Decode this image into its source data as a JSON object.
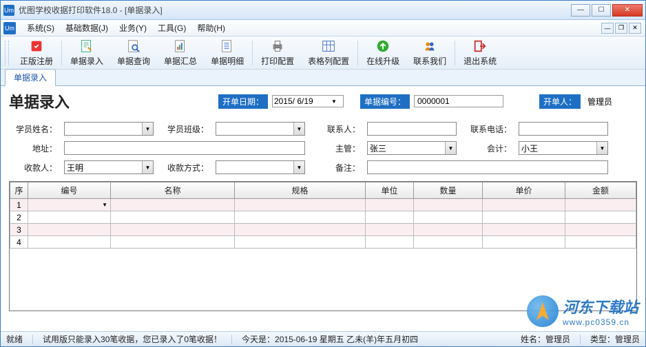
{
  "window": {
    "title": "优图学校收据打印软件18.0 - [单据录入]",
    "app_icon": "Um"
  },
  "menu": {
    "items": [
      "系统(S)",
      "基础数据(J)",
      "业务(Y)",
      "工具(G)",
      "帮助(H)"
    ]
  },
  "toolbar": {
    "items": [
      {
        "label": "正版注册",
        "icon": "register"
      },
      {
        "label": "单据录入",
        "icon": "input"
      },
      {
        "label": "单据查询",
        "icon": "query"
      },
      {
        "label": "单据汇总",
        "icon": "summary"
      },
      {
        "label": "单据明细",
        "icon": "detail"
      },
      {
        "label": "打印配置",
        "icon": "print"
      },
      {
        "label": "表格列配置",
        "icon": "columns"
      },
      {
        "label": "在线升级",
        "icon": "upgrade"
      },
      {
        "label": "联系我们",
        "icon": "contact"
      },
      {
        "label": "退出系统",
        "icon": "exit"
      }
    ]
  },
  "tab": {
    "label": "单据录入"
  },
  "page": {
    "title": "单据录入"
  },
  "header": {
    "date_label": "开单日期：",
    "date_value": "2015/ 6/19",
    "number_label": "单据编号：",
    "number_value": "0000001",
    "opener_label": "开单人：",
    "opener_value": "管理员"
  },
  "form": {
    "student_name": {
      "label": "学员姓名：",
      "value": ""
    },
    "student_class": {
      "label": "学员班级：",
      "value": ""
    },
    "contact_person": {
      "label": "联系人：",
      "value": ""
    },
    "contact_phone": {
      "label": "联系电话：",
      "value": ""
    },
    "address": {
      "label": "地址：",
      "value": ""
    },
    "supervisor": {
      "label": "主管：",
      "value": "张三"
    },
    "accountant": {
      "label": "会计：",
      "value": "小王"
    },
    "payee": {
      "label": "收款人：",
      "value": "王明"
    },
    "pay_method": {
      "label": "收款方式：",
      "value": ""
    },
    "remark": {
      "label": "备注：",
      "value": ""
    }
  },
  "grid": {
    "cols": [
      "序",
      "编号",
      "名称",
      "规格",
      "单位",
      "数量",
      "单价",
      "金额"
    ],
    "rows": [
      1,
      2,
      3,
      4
    ]
  },
  "status": {
    "ready": "就绪",
    "trial": "试用版只能录入30笔收据，您已录入了0笔收据！",
    "today": "今天是：2015-06-19 星期五 乙未(羊)年五月初四",
    "user_label": "姓名：",
    "user_value": "管理员",
    "type_label": "类型：",
    "type_value": "管理员"
  },
  "watermark": {
    "line1": "河东下载站",
    "line2": "www.pc0359.cn"
  }
}
